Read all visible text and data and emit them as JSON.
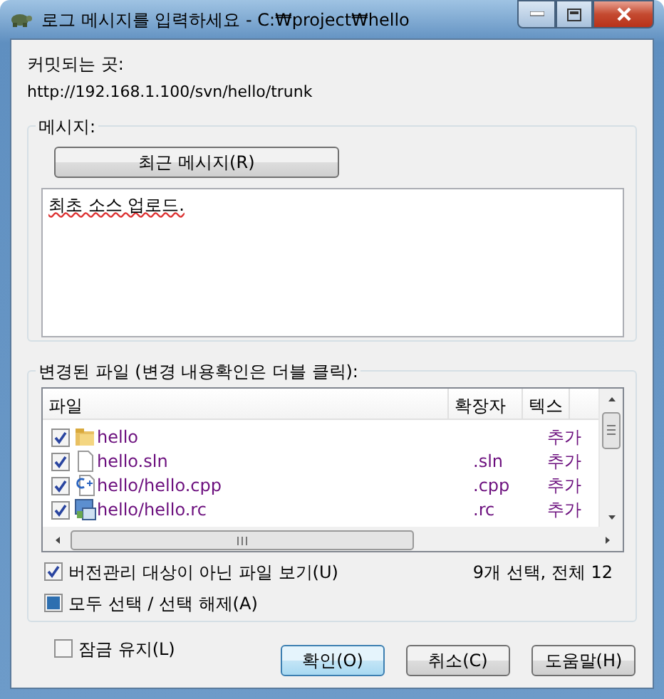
{
  "window": {
    "title": "로그 메시지를 입력하세요 - C:₩project₩hello"
  },
  "commit_to": {
    "label": "커밋되는 곳:",
    "url": "http://192.168.1.100/svn/hello/trunk"
  },
  "message_group": {
    "title": "메시지:",
    "recent_button": "최근 메시지(R)",
    "text": "최초 소스 업로드."
  },
  "files_group": {
    "title": "변경된 파일 (변경 내용확인은 더블 클릭):",
    "columns": [
      "파일",
      "확장자",
      "텍스"
    ],
    "rows": [
      {
        "kind": "folder",
        "path": "hello",
        "ext": "",
        "status": "추가",
        "checked": true
      },
      {
        "kind": "file",
        "path": "hello.sln",
        "ext": ".sln",
        "status": "추가",
        "checked": true
      },
      {
        "kind": "cpp",
        "path": "hello/hello.cpp",
        "ext": ".cpp",
        "status": "추가",
        "checked": true
      },
      {
        "kind": "rc",
        "path": "hello/hello.rc",
        "ext": ".rc",
        "status": "추가",
        "checked": true
      }
    ],
    "options": [
      {
        "label": "버전관리 대상이 아닌 파일 보기(U)",
        "checked": true
      },
      {
        "label": "모두 선택 / 선택 해제(A)",
        "indeterminate": true
      }
    ],
    "summary": "9개 선택, 전체 12"
  },
  "keep_locks": {
    "label": "잠금 유지(L)",
    "checked": false
  },
  "buttons": [
    {
      "label": "확인(O)",
      "default": true
    },
    {
      "label": "취소(C)",
      "default": false
    },
    {
      "label": "도움말(H)",
      "default": false
    }
  ]
}
